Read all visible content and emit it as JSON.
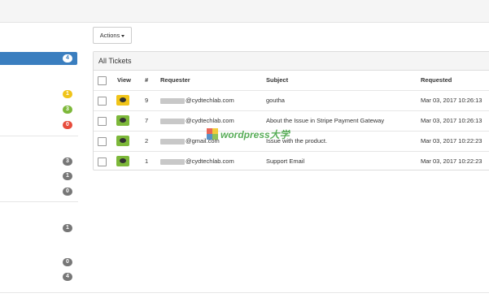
{
  "toolbar": {
    "actions_label": "Actions"
  },
  "sidebar": {
    "badges": [
      {
        "value": "4",
        "color": "white"
      },
      {
        "value": "1",
        "color": "#f0c419"
      },
      {
        "value": "3",
        "color": "#7db83a"
      },
      {
        "value": "0",
        "color": "#e74c3c"
      },
      {
        "value": "3",
        "color": "#777777"
      },
      {
        "value": "1",
        "color": "#777777"
      },
      {
        "value": "0",
        "color": "#777777"
      },
      {
        "value": "1",
        "color": "#777777"
      },
      {
        "value": "0",
        "color": "#777777"
      },
      {
        "value": "4",
        "color": "#777777"
      }
    ]
  },
  "panel": {
    "title": "All Tickets"
  },
  "table": {
    "headers": {
      "view": "View",
      "num": "#",
      "requester": "Requester",
      "subject": "Subject",
      "requested": "Requested"
    },
    "rows": [
      {
        "view_color": "yellow",
        "num": "9",
        "requester": "@cydtechlab.com",
        "subject": "goutha",
        "requested": "Mar 03, 2017 10:26:13"
      },
      {
        "view_color": "green",
        "num": "7",
        "requester": "@cydtechlab.com",
        "subject": "About the Issue in Stripe Payment Gateway",
        "requested": "Mar 03, 2017 10:26:13"
      },
      {
        "view_color": "green",
        "num": "2",
        "requester": "@gmail.com",
        "subject": "Issue with the product.",
        "requested": "Mar 03, 2017 10:22:23"
      },
      {
        "view_color": "green",
        "num": "1",
        "requester": "@cydtechlab.com",
        "subject": "Support Email",
        "requested": "Mar 03, 2017 10:22:23"
      }
    ]
  },
  "watermark": {
    "text": "wordpress大学"
  }
}
